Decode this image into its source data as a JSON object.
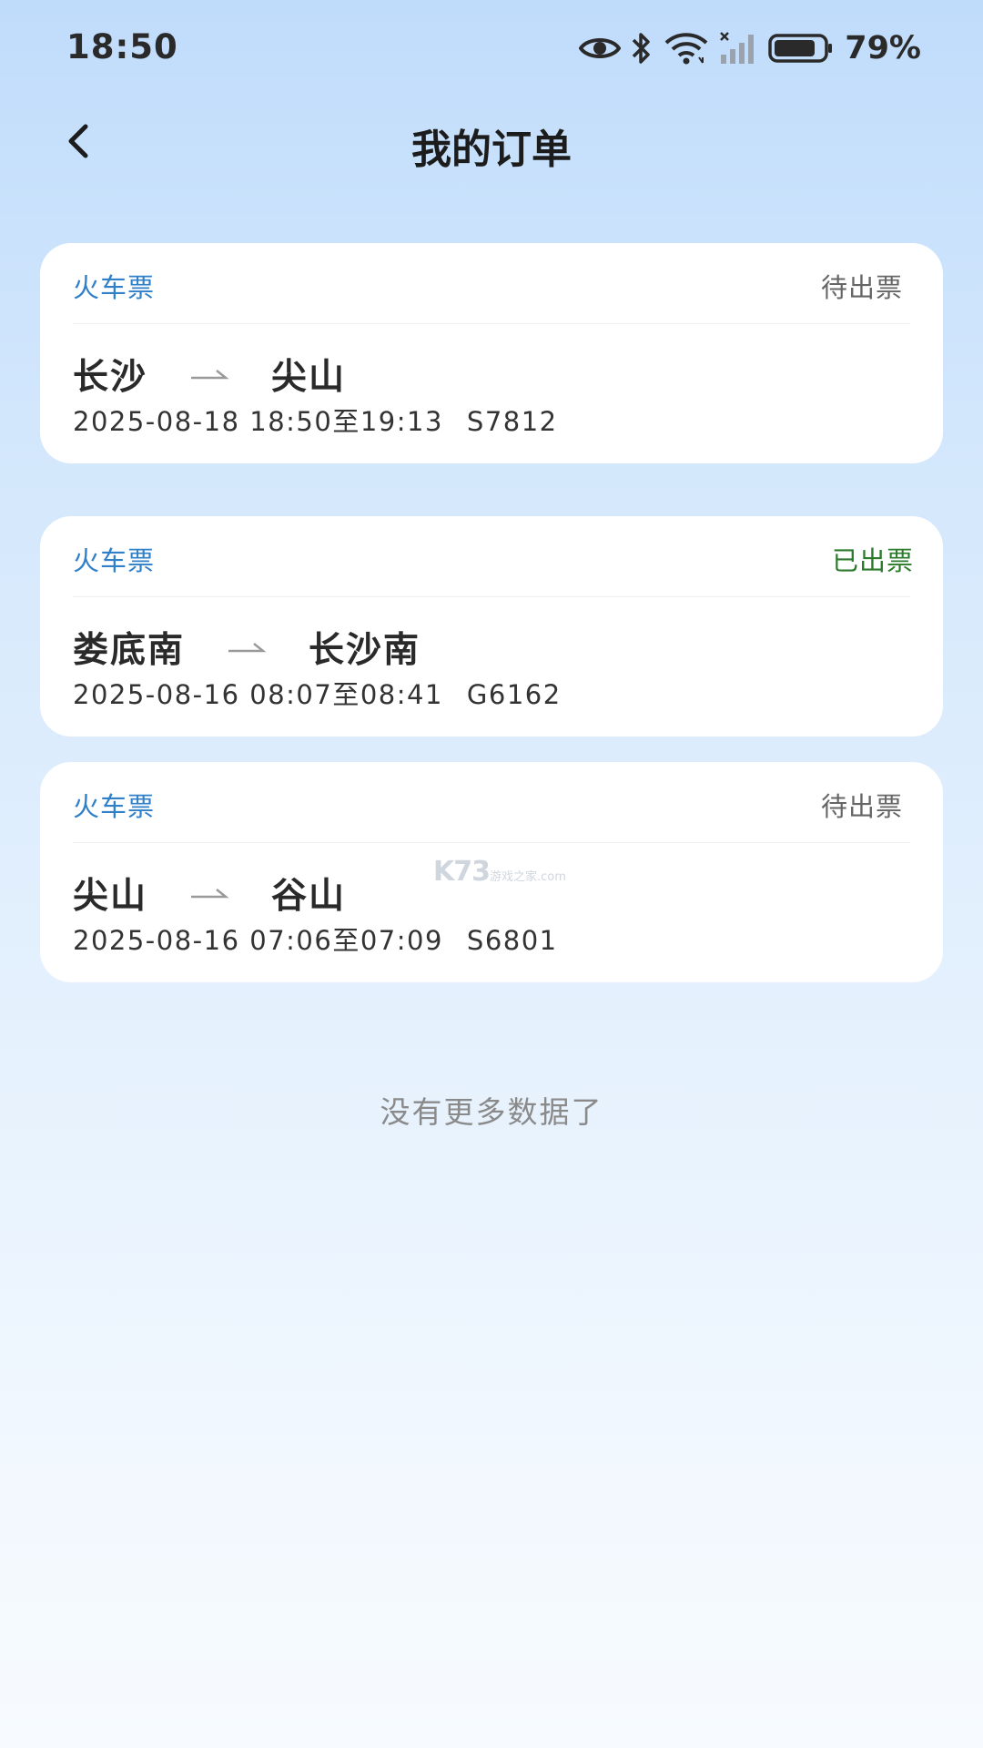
{
  "status_bar": {
    "time": "18:50",
    "battery": "79%",
    "icons": [
      "eye-icon",
      "bluetooth-icon",
      "wifi-icon",
      "signal-icon",
      "battery-icon"
    ]
  },
  "header": {
    "title": "我的订单",
    "back_icon": "chevron-left-icon"
  },
  "orders": [
    {
      "type": "火车票",
      "status": "待出票",
      "from": "长沙",
      "to": "尖山",
      "datetime": "2025-08-18 18:50至19:13",
      "train": "S7812"
    },
    {
      "type": "火车票",
      "status": "已出票",
      "from": "娄底南",
      "to": "长沙南",
      "datetime": "2025-08-16 08:07至08:41",
      "train": "G6162"
    },
    {
      "type": "火车票",
      "status": "待出票",
      "from": "尖山",
      "to": "谷山",
      "datetime": "2025-08-16 07:06至07:09",
      "train": "S6801"
    }
  ],
  "footer": {
    "no_more": "没有更多数据了"
  },
  "watermark": {
    "logo": "K73",
    "sub": "游戏之家",
    "domain": ".com"
  },
  "colors": {
    "ticket_type": "#2f7fc9",
    "status_pending": "#666666",
    "status_issued": "#2b7a2b"
  }
}
